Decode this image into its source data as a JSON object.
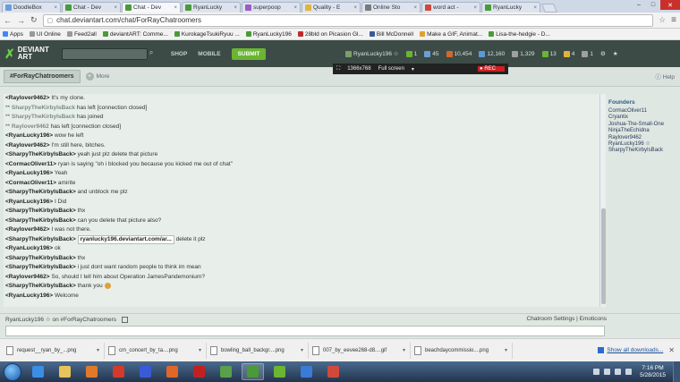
{
  "browser": {
    "tabs": [
      {
        "label": "DoodleBox",
        "fav": "#6a9fd8",
        "active": false
      },
      {
        "label": "Chat - Dev",
        "fav": "#4a9a3a",
        "active": false
      },
      {
        "label": "Chat - Dev",
        "fav": "#4a9a3a",
        "active": true
      },
      {
        "label": "RyanLucky",
        "fav": "#4a9a3a",
        "active": false
      },
      {
        "label": "superpoop",
        "fav": "#9b5bc9",
        "active": false
      },
      {
        "label": "Quality - E",
        "fav": "#e0b43a",
        "active": false
      },
      {
        "label": "Online Sto",
        "fav": "#7a7a7a",
        "active": false
      },
      {
        "label": "word act -",
        "fav": "#d0493a",
        "active": false
      },
      {
        "label": "RyanLucky",
        "fav": "#4a9a3a",
        "active": false
      }
    ],
    "url": "chat.deviantart.com/chat/ForRayChatroomers",
    "bookmarks": [
      {
        "label": "Apps",
        "color": "#4285f4"
      },
      {
        "label": "UI Online",
        "color": "#999999"
      },
      {
        "label": "Feed2all",
        "color": "#999999"
      },
      {
        "label": "deviantART: Comme...",
        "color": "#4a9a3a"
      },
      {
        "label": "KurokageTsukiRyuu ...",
        "color": "#4a9a3a"
      },
      {
        "label": "RyanLucky196",
        "color": "#4a9a3a"
      },
      {
        "label": "28bld on Picasion Gl...",
        "color": "#c02a2a"
      },
      {
        "label": "Bill McDonnell",
        "color": "#3b5998"
      },
      {
        "label": "Make a GIF, Animat...",
        "color": "#e0a030"
      },
      {
        "label": "Lisa-the-hedgie - D...",
        "color": "#4a9a3a"
      }
    ]
  },
  "header": {
    "logo_line1": "DEVIANT",
    "logo_line2": "ART",
    "nav": [
      "SHOP",
      "MOBILE"
    ],
    "submit": "SUBMIT",
    "user": "RyanLucky196",
    "stats": [
      {
        "value": "1",
        "color": "#6ab531"
      },
      {
        "value": "45",
        "color": "#6a9fd8"
      },
      {
        "value": "10,454",
        "color": "#d06a2a"
      },
      {
        "value": "12,160",
        "color": "#5a9ad8"
      },
      {
        "value": "1,329",
        "color": "#a0a0a0"
      },
      {
        "value": "13",
        "color": "#6ab531"
      },
      {
        "value": "4",
        "color": "#e0b43a"
      },
      {
        "value": "1",
        "color": "#a0a0a0"
      }
    ]
  },
  "recorder": {
    "resolution": "1366x768",
    "mode": "Full screen",
    "rec": "REC"
  },
  "chatbar": {
    "room_tab": "#ForRayChatroomers",
    "more": "More",
    "help": "Help"
  },
  "chat": {
    "lines": [
      {
        "type": "msg",
        "user": "<Raylover9462>",
        "text": "It's my clone."
      },
      {
        "type": "sys",
        "user": "** SharpyTheKirbyIsBack",
        "text": "has left [connection closed]"
      },
      {
        "type": "sys",
        "user": "** SharpyTheKirbyIsBack",
        "text": "has joined"
      },
      {
        "type": "sys",
        "user": "** Raylover9462",
        "text": "has left [connection closed]"
      },
      {
        "type": "msg",
        "user": "<RyanLucky196>",
        "text": "wow he left"
      },
      {
        "type": "msg",
        "user": "<Raylover9462>",
        "text": "I'm still here, bitches."
      },
      {
        "type": "msg",
        "user": "<SharpyTheKirbyIsBack>",
        "text": "yeah just plz delete that picture"
      },
      {
        "type": "msg",
        "user": "<CormacOliver11>",
        "text": "ryan is saying \"oh i blocked you because you kicked me out of chat\""
      },
      {
        "type": "msg",
        "user": "<RyanLucky196>",
        "text": "Yeah"
      },
      {
        "type": "msg",
        "user": "<CormacOliver11>",
        "text": "amirite"
      },
      {
        "type": "msg",
        "user": "<SharpyTheKirbyIsBack>",
        "text": "and unblock me plz"
      },
      {
        "type": "msg",
        "user": "<RyanLucky196>",
        "text": "I Did"
      },
      {
        "type": "msg",
        "user": "<SharpyTheKirbyIsBack>",
        "text": "thx"
      },
      {
        "type": "msg",
        "user": "<SharpyTheKirbyIsBack>",
        "text": "can you delete that picture also?"
      },
      {
        "type": "msg",
        "user": "<Raylover9462>",
        "text": "I was not there."
      },
      {
        "type": "link",
        "user": "<SharpyTheKirbyIsBack>",
        "link": "ryanlucky196.deviantart.com/ar...",
        "text": "delete it plz"
      },
      {
        "type": "msg",
        "user": "<RyanLucky196>",
        "text": "ok"
      },
      {
        "type": "msg",
        "user": "<SharpyTheKirbyIsBack>",
        "text": "thx"
      },
      {
        "type": "msg",
        "user": "<SharpyTheKirbyIsBack>",
        "text": "i just dont want random people to think im mean"
      },
      {
        "type": "msg",
        "user": "<Raylover9462>",
        "text": "So, should I tell him about Operation JamesPandemonium?"
      },
      {
        "type": "smile",
        "user": "<SharpyTheKirbyIsBack>",
        "text": "thank you"
      },
      {
        "type": "msg",
        "user": "<RyanLucky196>",
        "text": "Welcome"
      }
    ]
  },
  "members": {
    "heading": "Founders",
    "list": [
      "CormacOliver11",
      "Cryantix",
      "Joshua-The-Small-One",
      "NinjaTheEchidna",
      "Raylover9462",
      "RyanLucky196 ☆",
      "SharpyTheKirbyIsBack"
    ]
  },
  "footer": {
    "status_user": "RyanLucky196 ☆",
    "status_on": "on",
    "status_room": "#ForRayChatroomers",
    "links": "Chatroom Settings | Emoticons"
  },
  "downloads": {
    "items": [
      "request__ryan_by_...png",
      "cm_concert_by_ta....png",
      "bowling_ball_backgr....png",
      "007_by_eevee268-d8....gif",
      "beachdaycommissio....png"
    ],
    "show_all": "Show all downloads..."
  },
  "taskbar": {
    "apps": [
      {
        "name": "ie-icon",
        "color": "#3a8ee6",
        "on": false
      },
      {
        "name": "explorer-icon",
        "color": "#e8c25a",
        "on": false
      },
      {
        "name": "media-player-icon",
        "color": "#e07a2a",
        "on": false
      },
      {
        "name": "stop-icon",
        "color": "#d33a2a",
        "on": false
      },
      {
        "name": "app-icon",
        "color": "#3a5ad8",
        "on": false
      },
      {
        "name": "firefox-icon",
        "color": "#e0662a",
        "on": false
      },
      {
        "name": "adobe-icon",
        "color": "#c22020",
        "on": false
      },
      {
        "name": "app2-icon",
        "color": "#5aa04a",
        "on": false
      },
      {
        "name": "chrome-icon",
        "color": "#4a9a3a",
        "on": true
      },
      {
        "name": "utorrent-icon",
        "color": "#6ab531",
        "on": false
      },
      {
        "name": "app3-icon",
        "color": "#3a7ad8",
        "on": false
      },
      {
        "name": "app4-icon",
        "color": "#d04a3a",
        "on": false
      }
    ],
    "time": "7:16 PM",
    "date": "5/28/2015"
  }
}
